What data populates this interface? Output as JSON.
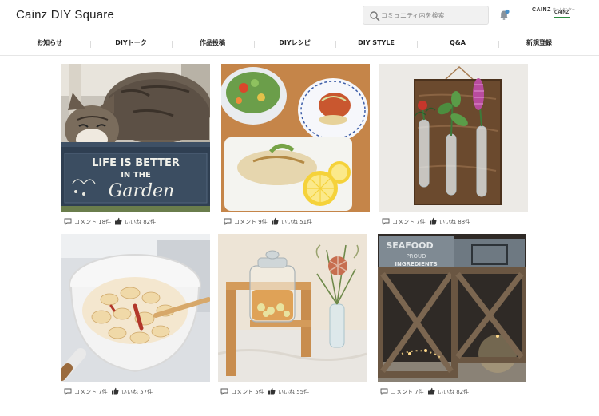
{
  "header": {
    "logo": "Cainz DIY Square",
    "search_placeholder": "コミュニティ内を検索",
    "brand": "CAINZ",
    "badge_brand": "CAINZ",
    "badge_tiny": "ホームセンター"
  },
  "nav": {
    "items": [
      {
        "label": "お知らせ"
      },
      {
        "label": "DIYトーク"
      },
      {
        "label": "作品投稿"
      },
      {
        "label": "DIYレシピ"
      },
      {
        "label": "DIY STYLE"
      },
      {
        "label": "Q&A"
      },
      {
        "label": "新規登録"
      }
    ]
  },
  "posts": [
    {
      "comment": "コメント 18件",
      "like": "いいね 82件",
      "image": "cat-on-garden-sign",
      "sign_line1": "LIFE IS BETTER",
      "sign_line2": "IN THE",
      "sign_line3": "Garden"
    },
    {
      "comment": "コメント 9件",
      "like": "いいね 51件",
      "image": "plated-dishes"
    },
    {
      "comment": "コメント 7件",
      "like": "いいね 88件",
      "image": "test-tube-flower-vases"
    },
    {
      "comment": "コメント 7件",
      "like": "いいね 57件",
      "image": "pot-of-snacks"
    },
    {
      "comment": "コメント 5件",
      "like": "いいね 55件",
      "image": "jar-on-wooden-shelf"
    },
    {
      "comment": "コメント 7件",
      "like": "いいね 82件",
      "image": "wooden-lantern-boxes",
      "box_line1": "SEAFOOD",
      "box_line2": "PROUD",
      "box_line3": "INGREDIENTS"
    }
  ],
  "colors": {
    "accent_blue": "#4a90c8",
    "badge_green": "#2a8a3e",
    "text_dark": "#222222",
    "meta_text": "#555555"
  }
}
